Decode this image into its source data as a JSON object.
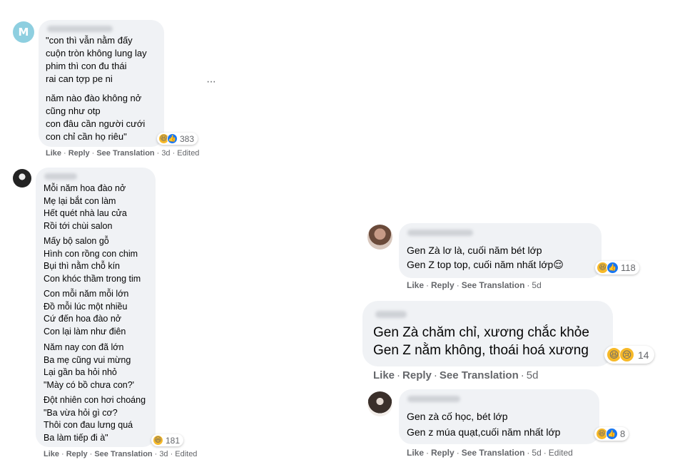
{
  "comments": [
    {
      "avatar_letter": "M",
      "lines_a": "\"con thì vẫn nằm đấy\ncuộn tròn không lung lay\nphim thì con đu thái\nrai can tợp pe ni",
      "lines_b": "năm nào đào không nở\ncũng như otp\ncon đâu cần người cưới\ncon chỉ cần họ riêu\"",
      "reaction_count": "383",
      "like": "Like",
      "reply": "Reply",
      "see_translation": "See Translation",
      "time": "3d",
      "edited": "Edited",
      "more": "···"
    },
    {
      "stanza_1": "Mỗi năm hoa đào nở\nMẹ lại bắt con làm\nHết quét nhà lau cửa\nRồi tới chùi salon",
      "stanza_2": "Mấy bộ salon gỗ\nHình con rồng con chim\nBụi thì nằm chỗ kín\nCon khóc thầm trong tim",
      "stanza_3": "Con mỗi năm mỗi lớn\nĐồ mỗi lúc một nhiều\nCứ đến hoa đào nở\nCon lại làm như điên",
      "stanza_4": "Năm nay con đã lớn\nBa mẹ cũng vui mừng\nLại gần ba hỏi nhỏ\n\"Mày có bồ chưa con?'",
      "stanza_5": "Đột nhiên con hơi choáng\n\"Ba vừa hỏi gì cơ?\nThôi con đau lưng quá\nBa làm tiếp đi à\"",
      "reaction_count": "181",
      "like": "Like",
      "reply": "Reply",
      "see_translation": "See Translation",
      "time": "3d",
      "edited": "Edited"
    },
    {
      "line_1": "Gen Zà lơ là, cuối năm bét lớp",
      "line_2": "Gen Z top top, cuối năm nhất lớp😌",
      "reaction_count": "118",
      "like": "Like",
      "reply": "Reply",
      "see_translation": "See Translation",
      "time": "5d"
    },
    {
      "line_1": "Gen Zà chăm chỉ, xương chắc khỏe",
      "line_2": "Gen Z nằm không, thoái hoá xương",
      "reaction_count": "14",
      "like": "Like",
      "reply": "Reply",
      "see_translation": "See Translation",
      "time": "5d"
    },
    {
      "line_1": "Gen zà cố học, bét lớp",
      "line_2": "Gen z múa quạt,cuối năm nhất lớp",
      "reaction_count": "8",
      "like": "Like",
      "reply": "Reply",
      "see_translation": "See Translation",
      "time": "5d",
      "edited": "Edited"
    }
  ],
  "colors": {
    "bubble": "#f0f2f5",
    "meta": "#65676b",
    "like_blue": "#1877f2",
    "haha_yellow": "#f7b928"
  },
  "icons": [
    "haha-emoji",
    "like-emoji",
    "sad-emoji",
    "more-options-icon"
  ]
}
